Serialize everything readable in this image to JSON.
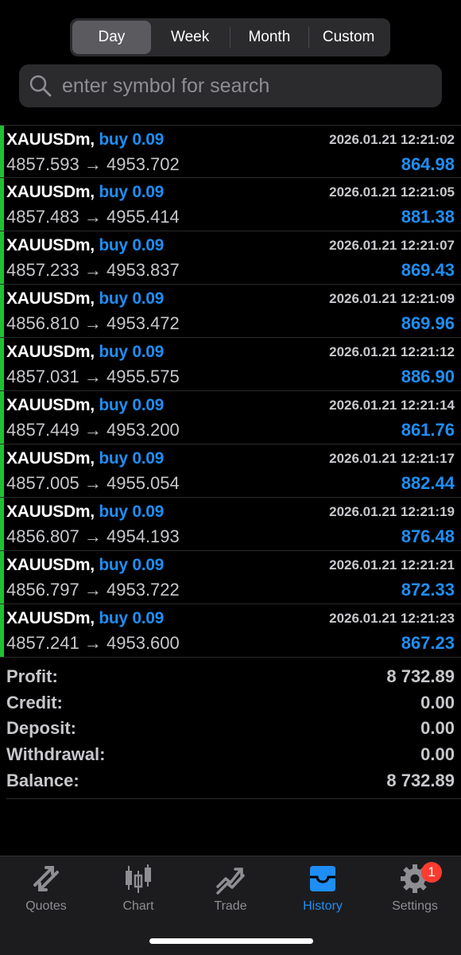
{
  "period_tabs": [
    "Day",
    "Week",
    "Month",
    "Custom"
  ],
  "active_period": "Day",
  "search": {
    "placeholder": "enter symbol for search"
  },
  "deals": [
    {
      "symbol": "XAUUSDm,",
      "type": "buy 0.09",
      "time": "2026.01.21 12:21:02",
      "open": "4857.593",
      "close": "4953.702",
      "profit": "864.98"
    },
    {
      "symbol": "XAUUSDm,",
      "type": "buy 0.09",
      "time": "2026.01.21 12:21:05",
      "open": "4857.483",
      "close": "4955.414",
      "profit": "881.38"
    },
    {
      "symbol": "XAUUSDm,",
      "type": "buy 0.09",
      "time": "2026.01.21 12:21:07",
      "open": "4857.233",
      "close": "4953.837",
      "profit": "869.43"
    },
    {
      "symbol": "XAUUSDm,",
      "type": "buy 0.09",
      "time": "2026.01.21 12:21:09",
      "open": "4856.810",
      "close": "4953.472",
      "profit": "869.96"
    },
    {
      "symbol": "XAUUSDm,",
      "type": "buy 0.09",
      "time": "2026.01.21 12:21:12",
      "open": "4857.031",
      "close": "4955.575",
      "profit": "886.90"
    },
    {
      "symbol": "XAUUSDm,",
      "type": "buy 0.09",
      "time": "2026.01.21 12:21:14",
      "open": "4857.449",
      "close": "4953.200",
      "profit": "861.76"
    },
    {
      "symbol": "XAUUSDm,",
      "type": "buy 0.09",
      "time": "2026.01.21 12:21:17",
      "open": "4857.005",
      "close": "4955.054",
      "profit": "882.44"
    },
    {
      "symbol": "XAUUSDm,",
      "type": "buy 0.09",
      "time": "2026.01.21 12:21:19",
      "open": "4856.807",
      "close": "4954.193",
      "profit": "876.48"
    },
    {
      "symbol": "XAUUSDm,",
      "type": "buy 0.09",
      "time": "2026.01.21 12:21:21",
      "open": "4856.797",
      "close": "4953.722",
      "profit": "872.33"
    },
    {
      "symbol": "XAUUSDm,",
      "type": "buy 0.09",
      "time": "2026.01.21 12:21:23",
      "open": "4857.241",
      "close": "4953.600",
      "profit": "867.23"
    }
  ],
  "summary": [
    {
      "label": "Profit:",
      "value": "8 732.89"
    },
    {
      "label": "Credit:",
      "value": "0.00"
    },
    {
      "label": "Deposit:",
      "value": "0.00"
    },
    {
      "label": "Withdrawal:",
      "value": "0.00"
    },
    {
      "label": "Balance:",
      "value": "8 732.89"
    }
  ],
  "tabs": [
    {
      "label": "Quotes",
      "icon": "quotes-arrows-icon"
    },
    {
      "label": "Chart",
      "icon": "candlestick-chart-icon"
    },
    {
      "label": "Trade",
      "icon": "trade-trend-icon"
    },
    {
      "label": "History",
      "icon": "inbox-tray-icon"
    },
    {
      "label": "Settings",
      "icon": "gear-icon",
      "badge": "1"
    }
  ],
  "active_tab": "History",
  "colors": {
    "accent": "#1e8ef5",
    "buy_bar": "#20c131",
    "badge": "#ff3b30"
  }
}
